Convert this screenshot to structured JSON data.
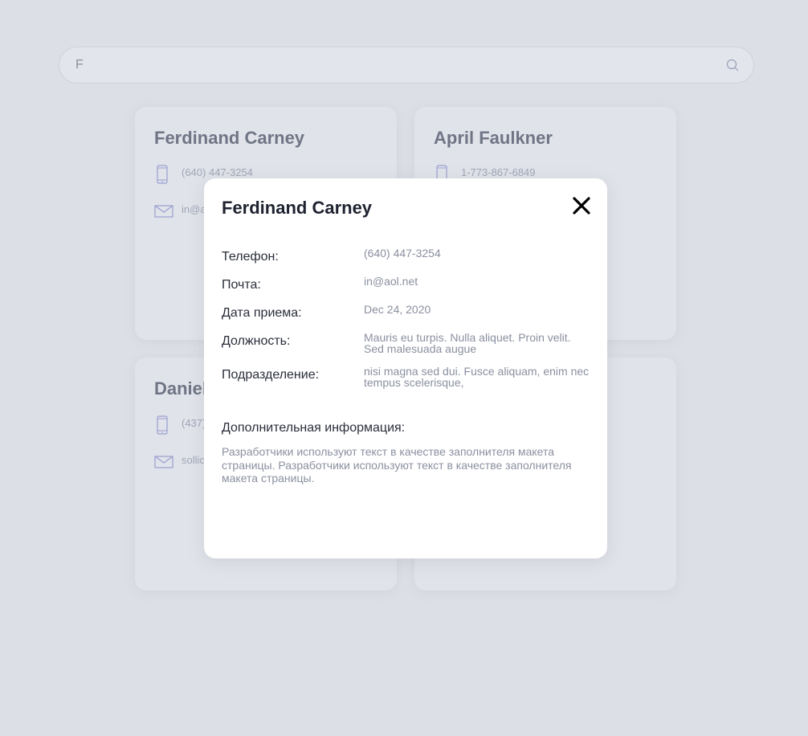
{
  "search": {
    "value": "F"
  },
  "cards": [
    {
      "name": "Ferdinand Carney",
      "phone": "(640) 447-3254",
      "email": "in@aol.net"
    },
    {
      "name": "April Faulkner",
      "phone": "1-773-867-6849",
      "email": ""
    },
    {
      "name": "Daniel",
      "phone": "(437)",
      "email": "sollic"
    },
    {
      "name": "",
      "phone": "",
      "email": ""
    }
  ],
  "modal": {
    "title": "Ferdinand Carney",
    "fields": [
      {
        "label": "Телефон:",
        "value": "(640) 447-3254"
      },
      {
        "label": "Почта:",
        "value": "in@aol.net"
      },
      {
        "label": "Дата приема:",
        "value": "Dec 24, 2020"
      },
      {
        "label": "Должность:",
        "value": "Mauris eu turpis. Nulla aliquet. Proin velit. Sed malesuada augue"
      },
      {
        "label": "Подразделение:",
        "value": "nisi magna sed dui. Fusce aliquam, enim nec tempus scelerisque,"
      }
    ],
    "extra_label": "Дополнительная информация:",
    "extra_text": "Разработчики используют текст в качестве заполнителя макета страницы. Разработчики используют текст в качестве заполнителя макета страницы."
  },
  "colors": {
    "background": "#dddfe6",
    "accent": "#8f93c8",
    "modal": "#ffffff"
  }
}
